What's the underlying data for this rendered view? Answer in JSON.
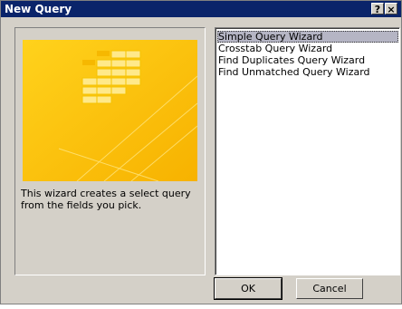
{
  "window": {
    "title": "New Query",
    "help_glyph": "?",
    "close_glyph": "×"
  },
  "preview": {
    "description": "This wizard creates a select query from the fields you pick."
  },
  "list": {
    "items": [
      {
        "label": "Simple Query Wizard",
        "selected": true
      },
      {
        "label": "Crosstab Query Wizard",
        "selected": false
      },
      {
        "label": "Find Duplicates Query Wizard",
        "selected": false
      },
      {
        "label": "Find Unmatched Query Wizard",
        "selected": false
      }
    ]
  },
  "buttons": {
    "ok_label": "OK",
    "cancel_label": "Cancel"
  },
  "colors": {
    "titlebar": "#0a246a",
    "art_yellow": "#ffcc11",
    "selection": "#b5b5c4"
  }
}
